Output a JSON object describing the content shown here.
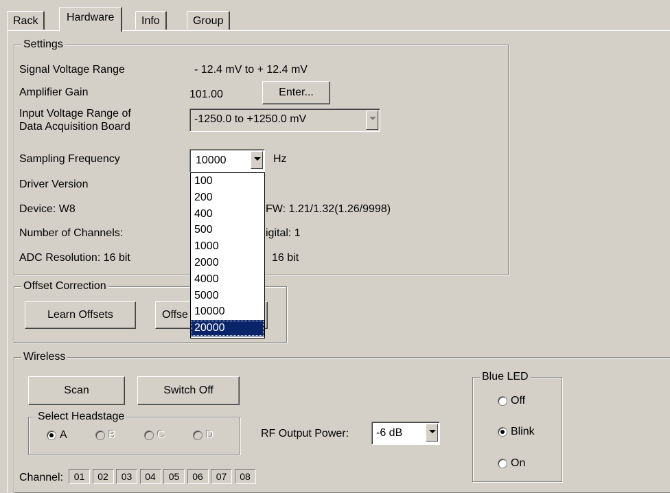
{
  "tabs": [
    "Rack",
    "Hardware",
    "Info",
    "Group"
  ],
  "settings": {
    "title": "Settings",
    "signal_voltage_label": "Signal Voltage Range",
    "signal_voltage_value": "- 12.4 mV to + 12.4 mV",
    "amplifier_gain_label": "Amplifier Gain",
    "amplifier_gain_value": "101.00",
    "enter_button": "Enter...",
    "input_range_label_1": "Input Voltage Range of",
    "input_range_label_2": "Data Acquisition Board",
    "input_range_value": "-1250.0 to +1250.0 mV",
    "sampling_label": "Sampling Frequency",
    "sampling_value": "10000",
    "sampling_unit": "Hz",
    "sampling_options": [
      "100",
      "200",
      "400",
      "500",
      "1000",
      "2000",
      "4000",
      "5000",
      "10000",
      "20000"
    ],
    "sampling_highlighted": "20000",
    "driver_version_label": "Driver Version",
    "device_label": "Device: W8",
    "fw_fragment": "FW: 1.21/1.32(1.26/9998)",
    "channels_label": "Number of Channels:",
    "digital_fragment": "igital: 1",
    "adc_label": "ADC Resolution: 16 bit",
    "adc_fragment": "16 bit"
  },
  "offset": {
    "title": "Offset Correction",
    "learn_button": "Learn Offsets",
    "offset_button_partial": "Offse"
  },
  "wireless": {
    "title": "Wireless",
    "scan_button": "Scan",
    "switch_off_button": "Switch Off",
    "headstage_title": "Select Headstage",
    "headstages": [
      "A",
      "B",
      "C",
      "D"
    ],
    "headstage_selected": "A",
    "rf_label": "RF Output Power:",
    "rf_value": "-6 dB",
    "channel_label": "Channel:",
    "channels": [
      "01",
      "02",
      "03",
      "04",
      "05",
      "06",
      "07",
      "08"
    ]
  },
  "blue_led": {
    "title": "Blue LED",
    "options": [
      "Off",
      "Blink",
      "On"
    ],
    "selected": "Blink"
  }
}
